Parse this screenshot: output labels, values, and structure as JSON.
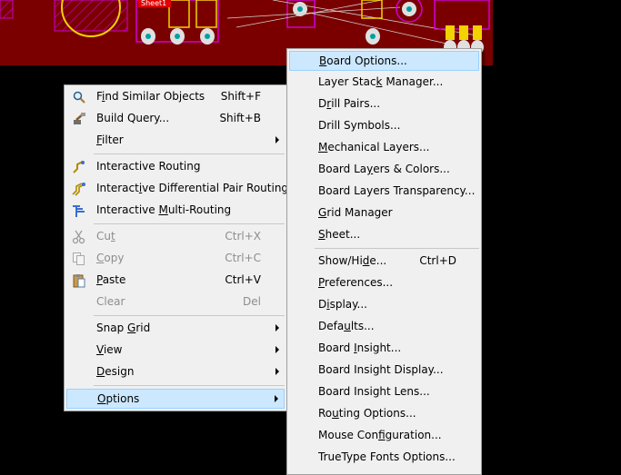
{
  "pcb": {
    "label": "Sheet1"
  },
  "context_menu": {
    "items": [
      {
        "label": "Find Similar Objects",
        "mn": "i",
        "shortcut": "Shift+F",
        "icon": "magnifier-icon",
        "enabled": true
      },
      {
        "label": "Build Query...",
        "mn": "",
        "shortcut": "Shift+B",
        "icon": "query-builder-icon",
        "enabled": true
      },
      {
        "label": "Filter",
        "mn": "F",
        "shortcut": "",
        "icon": "",
        "enabled": true,
        "submenu": true
      },
      {
        "label": "Interactive Routing",
        "mn": "",
        "shortcut": "",
        "icon": "interactive-routing-icon",
        "enabled": true
      },
      {
        "label": "Interactive Differential Pair Routing",
        "mn": "i",
        "shortcut": "",
        "icon": "diff-pair-routing-icon",
        "enabled": true
      },
      {
        "label": "Interactive Multi-Routing",
        "mn": "M",
        "shortcut": "",
        "icon": "multi-routing-icon",
        "enabled": true
      },
      {
        "label": "Cut",
        "mn": "t",
        "shortcut": "Ctrl+X",
        "icon": "scissors-icon",
        "enabled": false
      },
      {
        "label": "Copy",
        "mn": "C",
        "shortcut": "Ctrl+C",
        "icon": "copy-icon",
        "enabled": false
      },
      {
        "label": "Paste",
        "mn": "P",
        "shortcut": "Ctrl+V",
        "icon": "paste-icon",
        "enabled": true
      },
      {
        "label": "Clear",
        "mn": "",
        "shortcut": "Del",
        "icon": "",
        "enabled": false
      },
      {
        "label": "Snap Grid",
        "mn": "G",
        "shortcut": "",
        "icon": "",
        "enabled": true,
        "submenu": true
      },
      {
        "label": "View",
        "mn": "V",
        "shortcut": "",
        "icon": "",
        "enabled": true,
        "submenu": true
      },
      {
        "label": "Design",
        "mn": "D",
        "shortcut": "",
        "icon": "",
        "enabled": true,
        "submenu": true
      },
      {
        "label": "Options",
        "mn": "O",
        "shortcut": "",
        "icon": "",
        "enabled": true,
        "submenu": true,
        "highlighted": true
      }
    ]
  },
  "options_submenu": {
    "items": [
      {
        "label": "Board Options...",
        "mn": "B",
        "shortcut": "",
        "highlighted": true
      },
      {
        "label": "Layer Stack Manager...",
        "mn": "k",
        "shortcut": ""
      },
      {
        "label": "Drill Pairs...",
        "mn": "r",
        "shortcut": ""
      },
      {
        "label": "Drill Symbols...",
        "mn": "",
        "shortcut": ""
      },
      {
        "label": "Mechanical Layers...",
        "mn": "M",
        "shortcut": ""
      },
      {
        "label": "Board Layers & Colors...",
        "mn": "y",
        "shortcut": ""
      },
      {
        "label": "Board Layers Transparency...",
        "mn": "",
        "shortcut": ""
      },
      {
        "label": "Grid Manager",
        "mn": "G",
        "shortcut": ""
      },
      {
        "label": "Sheet...",
        "mn": "S",
        "shortcut": ""
      },
      {
        "label": "Show/Hide...",
        "mn": "d",
        "shortcut": "Ctrl+D"
      },
      {
        "label": "Preferences...",
        "mn": "P",
        "shortcut": ""
      },
      {
        "label": "Display...",
        "mn": "i",
        "shortcut": ""
      },
      {
        "label": "Defaults...",
        "mn": "u",
        "shortcut": ""
      },
      {
        "label": "Board Insight...",
        "mn": "I",
        "shortcut": ""
      },
      {
        "label": "Board Insight Display...",
        "mn": "",
        "shortcut": ""
      },
      {
        "label": "Board Insight Lens...",
        "mn": "",
        "shortcut": ""
      },
      {
        "label": "Routing Options...",
        "mn": "u",
        "shortcut": ""
      },
      {
        "label": "Mouse Configuration...",
        "mn": "f",
        "shortcut": ""
      },
      {
        "label": "TrueType Fonts Options...",
        "mn": "",
        "shortcut": ""
      }
    ]
  }
}
